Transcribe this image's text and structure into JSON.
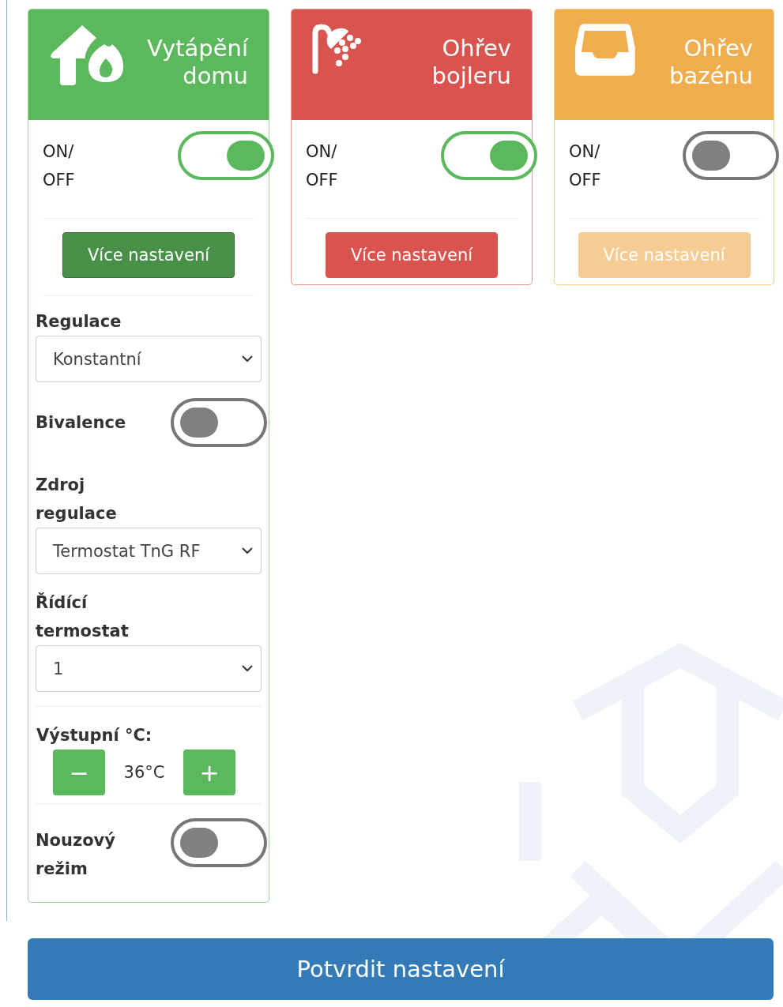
{
  "cards": [
    {
      "kind": "heating",
      "title": "Vytápění domu",
      "color": "#5cb85c",
      "power_label": "ON/ OFF",
      "on": true,
      "expanded": true,
      "more_button": {
        "label": "Více nastavení",
        "disabled": false
      },
      "settings": [
        {
          "kind": "select",
          "label": "Regulace",
          "value": "Konstantní"
        },
        {
          "kind": "toggle",
          "label": "Bivalence",
          "on": false
        },
        {
          "kind": "select",
          "label": "Zdroj regulace",
          "value": "Termostat TnG RF"
        },
        {
          "kind": "select",
          "label": "Řídící termostat",
          "value": "1"
        },
        {
          "kind": "stepper",
          "label": "Výstupní °C:",
          "value": "36°C",
          "minus": "−",
          "plus": "+"
        },
        {
          "kind": "toggle",
          "label": "Nouzový režim",
          "on": false
        }
      ]
    },
    {
      "kind": "boiler",
      "title": "Ohřev bojleru",
      "color": "#d9534f",
      "power_label": "ON/ OFF",
      "on": true,
      "expanded": false,
      "more_button": {
        "label": "Více nastavení",
        "disabled": false
      }
    },
    {
      "kind": "pool",
      "title": "Ohřev bazénu",
      "color": "#f0ad4e",
      "power_label": "ON/ OFF",
      "on": false,
      "expanded": false,
      "more_button": {
        "label": "Více nastavení",
        "disabled": true
      }
    }
  ],
  "confirm_button": "Potvrdit nastavení"
}
